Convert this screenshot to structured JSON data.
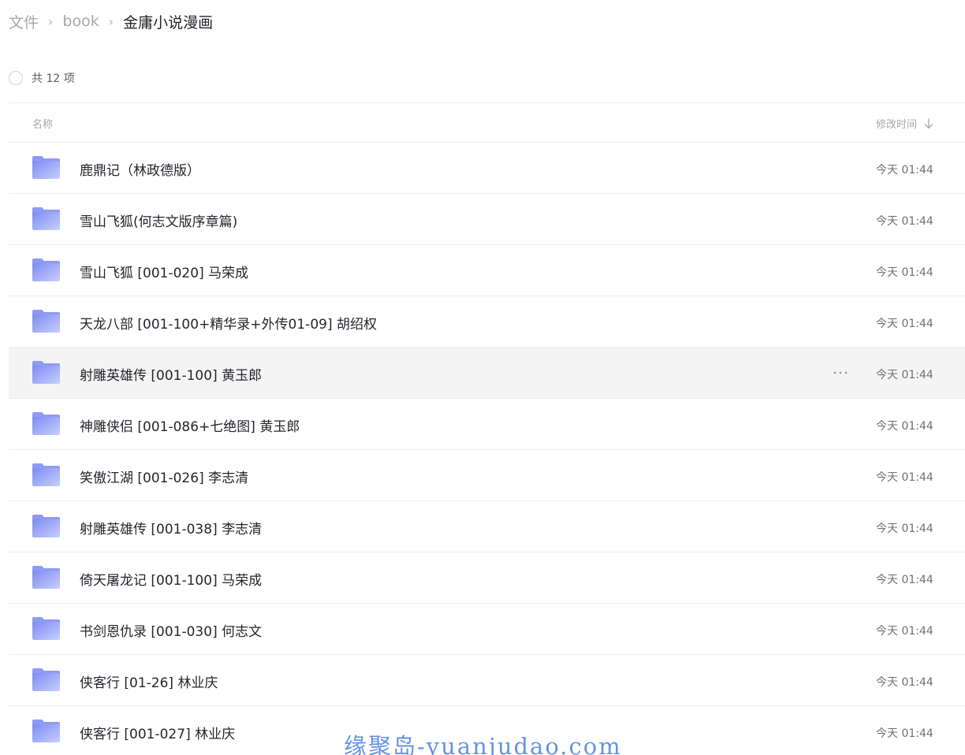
{
  "breadcrumb": {
    "root": "文件",
    "parent": "book",
    "current": "金庸小说漫画",
    "separator": "›"
  },
  "count_label": "共 12 项",
  "header": {
    "name": "名称",
    "time": "修改时间"
  },
  "colors": {
    "folder_light": "#c7cefc",
    "folder_dark": "#7d8cf3",
    "hover_bg": "#f4f4f5"
  },
  "files": [
    {
      "name": "鹿鼎记（林政德版）",
      "time": "今天 01:44"
    },
    {
      "name": "雪山飞狐(何志文版序章篇)",
      "time": "今天 01:44"
    },
    {
      "name": "雪山飞狐 [001-020] 马荣成",
      "time": "今天 01:44"
    },
    {
      "name": "天龙八部 [001-100+精华录+外传01-09] 胡绍权",
      "time": "今天 01:44"
    },
    {
      "name": "射雕英雄传 [001-100] 黄玉郎",
      "time": "今天 01:44",
      "hover": true
    },
    {
      "name": "神雕侠侣 [001-086+七绝图] 黄玉郎",
      "time": "今天 01:44"
    },
    {
      "name": "笑傲江湖 [001-026] 李志清",
      "time": "今天 01:44"
    },
    {
      "name": "射雕英雄传 [001-038] 李志清",
      "time": "今天 01:44"
    },
    {
      "name": "倚天屠龙记 [001-100] 马荣成",
      "time": "今天 01:44"
    },
    {
      "name": "书剑恩仇录 [001-030] 何志文",
      "time": "今天 01:44"
    },
    {
      "name": "侠客行 [01-26] 林业庆",
      "time": "今天 01:44"
    },
    {
      "name": "侠客行 [001-027] 林业庆",
      "time": "今天 01:44"
    }
  ],
  "watermark": "缘聚岛-yuanjudao.com"
}
